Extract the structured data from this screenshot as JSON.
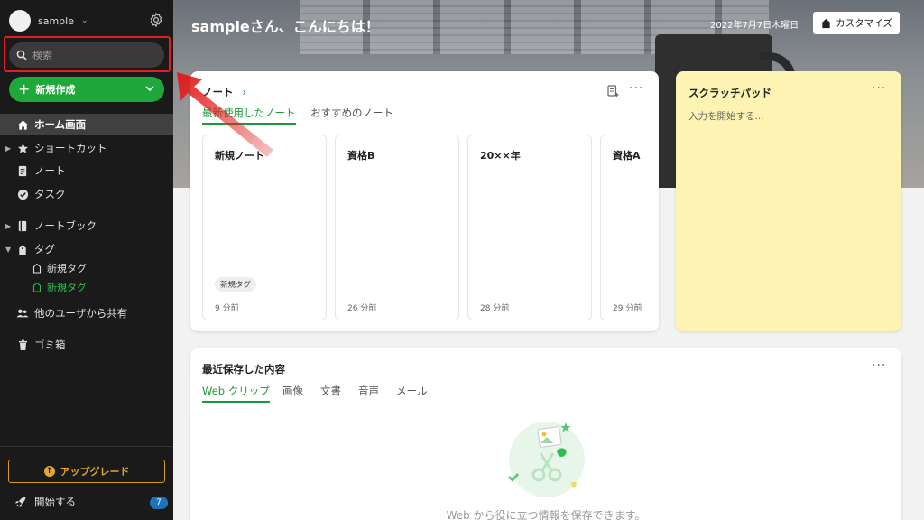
{
  "sidebar": {
    "account_name": "sample",
    "search_placeholder": "検索",
    "new_button": "新規作成",
    "nav": {
      "home": "ホーム画面",
      "shortcuts": "ショートカット",
      "notes": "ノート",
      "tasks": "タスク",
      "notebooks": "ノートブック",
      "tags": "タグ",
      "tag_items": [
        "新規タグ",
        "新規タグ"
      ],
      "shared": "他のユーザから共有",
      "trash": "ゴミ箱"
    },
    "upgrade": "アップグレード",
    "get_started": "開始する",
    "get_started_badge": "7"
  },
  "hero": {
    "greeting": "sampleさん、こんにちは！",
    "date": "2022年7月7日木曜日",
    "customize": "カスタマイズ"
  },
  "notes_card": {
    "title": "ノート",
    "tabs": [
      "最新使用したノート",
      "おすすめのノート"
    ],
    "items": [
      {
        "title": "新規ノート",
        "tag": "新規タグ",
        "time": "9 分前"
      },
      {
        "title": "資格B",
        "tag": "",
        "time": "26 分前"
      },
      {
        "title": "20××年",
        "tag": "",
        "time": "28 分前"
      },
      {
        "title": "資格A",
        "tag": "",
        "time": "29 分前"
      }
    ]
  },
  "scratch_pad": {
    "title": "スクラッチパッド",
    "placeholder": "入力を開始する..."
  },
  "recent": {
    "title": "最近保存した内容",
    "tabs": [
      "Web クリップ",
      "画像",
      "文書",
      "音声",
      "メール"
    ],
    "empty_message": "Web から役に立つ情報を保存できます。"
  },
  "colors": {
    "accent_green": "#1fa83a",
    "highlight_red": "#e02020",
    "upgrade_gold": "#e3a62b",
    "sidebar_bg": "#1a1a1a",
    "scratch_bg": "#fdf3b2"
  }
}
